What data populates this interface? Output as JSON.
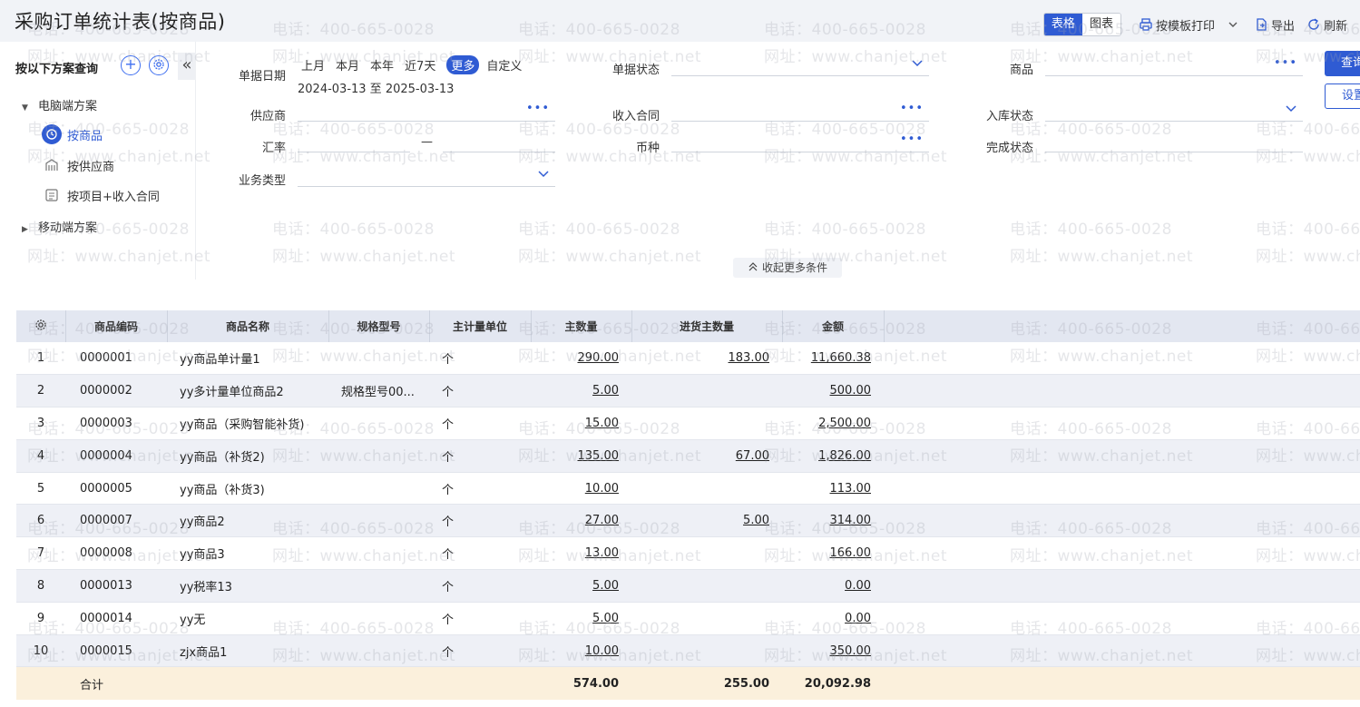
{
  "page": {
    "title": "采购订单统计表(按商品)"
  },
  "toolbar": {
    "view_table": "表格",
    "view_chart": "图表",
    "print": "按模板打印",
    "export": "导出",
    "refresh": "刷新"
  },
  "scheme": {
    "heading": "按以下方案查询",
    "desktop_group": "电脑端方案",
    "mobile_group": "移动端方案",
    "items": [
      {
        "label": "按商品",
        "icon": "clock-icon"
      },
      {
        "label": "按供应商",
        "icon": "building-icon"
      },
      {
        "label": "按项目+收入合同",
        "icon": "list-icon"
      }
    ]
  },
  "filters": {
    "date_label": "单据日期",
    "date_options": [
      "上月",
      "本月",
      "本年",
      "近7天",
      "更多",
      "自定义"
    ],
    "date_selected": "更多",
    "date_range": "2024-03-13 至 2025-03-13",
    "supplier_label": "供应商",
    "exchange_label": "汇率",
    "exchange_dash": "—",
    "biz_type_label": "业务类型",
    "doc_status_label": "单据状态",
    "income_contract_label": "收入合同",
    "currency_label": "币种",
    "product_label": "商品",
    "inbound_status_label": "入库状态",
    "finish_status_label": "完成状态",
    "query_button": "查询",
    "settings_button": "设置",
    "collapse_more": "收起更多条件"
  },
  "table": {
    "headers": [
      "商品编码",
      "商品名称",
      "规格型号",
      "主计量单位",
      "主数量",
      "进货主数量",
      "金额"
    ],
    "rows": [
      {
        "idx": "1",
        "code": "0000001",
        "name": "yy商品单计量1",
        "spec": "",
        "unit": "个",
        "qty": "290.00",
        "in_qty": "183.00",
        "amount": "11,660.38"
      },
      {
        "idx": "2",
        "code": "0000002",
        "name": "yy多计量单位商品2",
        "spec": "规格型号00...",
        "unit": "个",
        "qty": "5.00",
        "in_qty": "",
        "amount": "500.00"
      },
      {
        "idx": "3",
        "code": "0000003",
        "name": "yy商品（采购智能补货)",
        "spec": "",
        "unit": "个",
        "qty": "15.00",
        "in_qty": "",
        "amount": "2,500.00"
      },
      {
        "idx": "4",
        "code": "0000004",
        "name": "yy商品（补货2)",
        "spec": "",
        "unit": "个",
        "qty": "135.00",
        "in_qty": "67.00",
        "amount": "1,826.00"
      },
      {
        "idx": "5",
        "code": "0000005",
        "name": "yy商品（补货3)",
        "spec": "",
        "unit": "个",
        "qty": "10.00",
        "in_qty": "",
        "amount": "113.00"
      },
      {
        "idx": "6",
        "code": "0000007",
        "name": "yy商品2",
        "spec": "",
        "unit": "个",
        "qty": "27.00",
        "in_qty": "5.00",
        "amount": "314.00"
      },
      {
        "idx": "7",
        "code": "0000008",
        "name": "yy商品3",
        "spec": "",
        "unit": "个",
        "qty": "13.00",
        "in_qty": "",
        "amount": "166.00"
      },
      {
        "idx": "8",
        "code": "0000013",
        "name": "yy税率13",
        "spec": "",
        "unit": "个",
        "qty": "5.00",
        "in_qty": "",
        "amount": "0.00"
      },
      {
        "idx": "9",
        "code": "0000014",
        "name": "yy无",
        "spec": "",
        "unit": "个",
        "qty": "5.00",
        "in_qty": "",
        "amount": "0.00"
      },
      {
        "idx": "10",
        "code": "0000015",
        "name": "zjx商品1",
        "spec": "",
        "unit": "个",
        "qty": "10.00",
        "in_qty": "",
        "amount": "350.00"
      }
    ],
    "total": {
      "label": "合计",
      "qty": "574.00",
      "in_qty": "255.00",
      "amount": "20,092.98"
    }
  },
  "watermark": {
    "phone": "电话：400-665-0028",
    "site": "网址：www.chanjet.net"
  },
  "colors": {
    "accent": "#2f5bd3",
    "header_bg": "#e3e7f1",
    "total_bg": "#fbf0dc"
  }
}
